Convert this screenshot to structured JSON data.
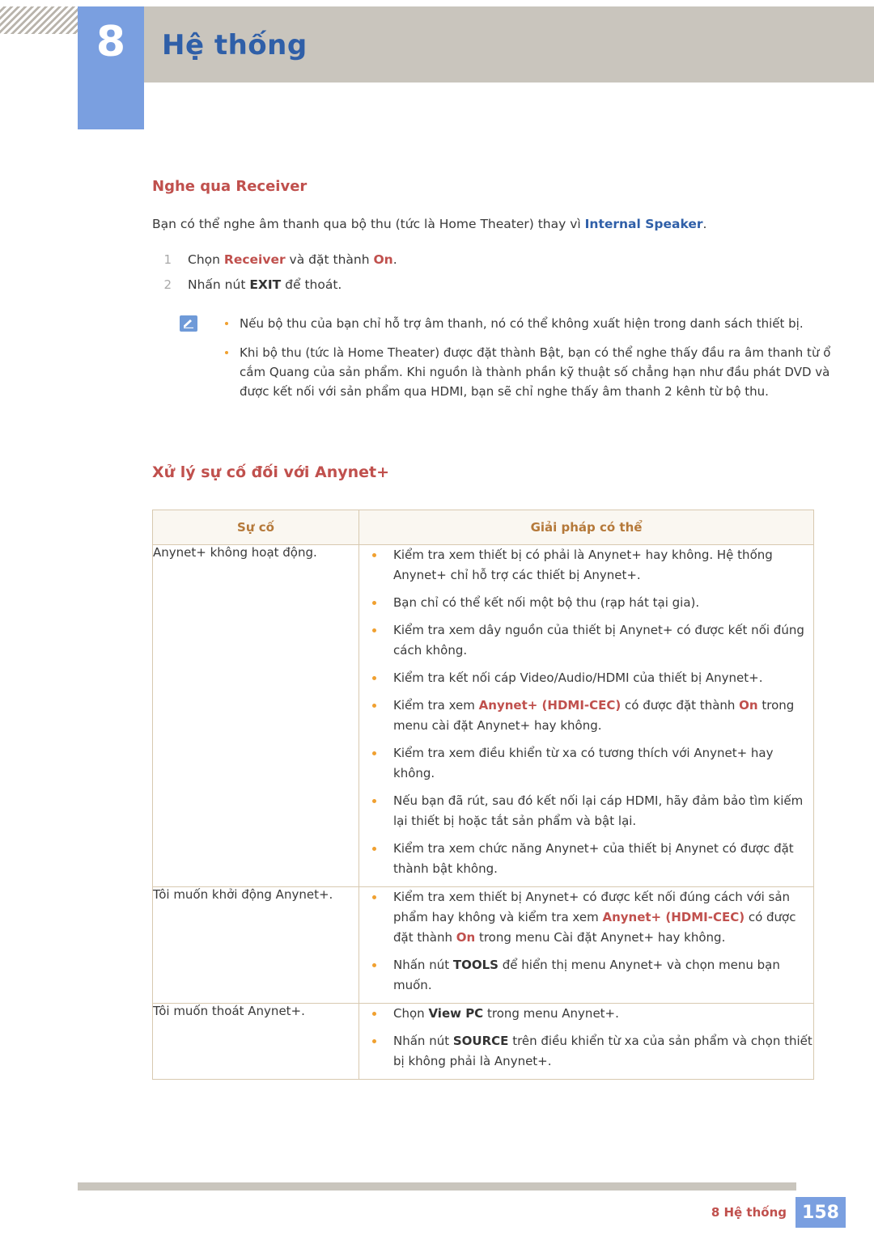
{
  "header": {
    "chapter_number": "8",
    "chapter_title": "Hệ thống"
  },
  "section1": {
    "title": "Nghe qua Receiver",
    "intro_pre": "Bạn có thể nghe âm thanh qua bộ thu (tức là Home Theater) thay vì ",
    "intro_kw": "Internal Speaker",
    "intro_post": ".",
    "steps": [
      {
        "num": "1",
        "pre": "Chọn ",
        "kw1": "Receiver",
        "mid": " và đặt thành ",
        "kw2": "On",
        "post": "."
      },
      {
        "num": "2",
        "pre": "Nhấn nút ",
        "kw1": "EXIT",
        "mid": " để thoát.",
        "kw2": "",
        "post": ""
      }
    ],
    "notes": [
      "Nếu bộ thu của bạn chỉ hỗ trợ âm thanh, nó có thể không xuất hiện trong danh sách thiết bị.",
      "Khi bộ thu (tức là Home Theater) được đặt thành Bật, bạn có thể nghe thấy đầu ra âm thanh từ ổ cắm Quang của sản phẩm. Khi nguồn là thành phần kỹ thuật số chẳng hạn như đầu phát DVD và được kết nối với sản phẩm qua HDMI, bạn sẽ chỉ nghe thấy âm thanh 2 kênh từ bộ thu."
    ]
  },
  "section2": {
    "title": "Xử lý sự cố đối với Anynet+",
    "table": {
      "headers": [
        "Sự cố",
        "Giải pháp có thể"
      ],
      "rows": [
        {
          "problem": "Anynet+ không hoạt động.",
          "solutions": [
            {
              "t1": "Kiểm tra xem thiết bị có phải là Anynet+ hay không. Hệ thống Anynet+ chỉ hỗ trợ các thiết bị Anynet+."
            },
            {
              "t1": "Bạn chỉ có thể kết nối một bộ thu (rạp hát tại gia)."
            },
            {
              "t1": "Kiểm tra xem dây nguồn của thiết bị Anynet+ có được kết nối đúng cách không."
            },
            {
              "t1": "Kiểm tra kết nối cáp Video/Audio/HDMI của thiết bị Anynet+."
            },
            {
              "t1": "Kiểm tra xem ",
              "kw1": "Anynet+ (HDMI-CEC)",
              "t2": " có được đặt thành ",
              "kw2": "On",
              "t3": " trong menu cài đặt Anynet+ hay không."
            },
            {
              "t1": "Kiểm tra xem điều khiển từ xa có tương thích với Anynet+ hay không."
            },
            {
              "t1": "Nếu bạn đã rút, sau đó kết nối lại cáp HDMI, hãy đảm bảo tìm kiếm lại thiết bị hoặc tắt sản phẩm và bật lại."
            },
            {
              "t1": "Kiểm tra xem chức năng Anynet+ của thiết bị Anynet có được đặt thành bật không."
            }
          ]
        },
        {
          "problem": "Tôi muốn khởi động Anynet+.",
          "solutions": [
            {
              "t1": "Kiểm tra xem thiết bị Anynet+ có được kết nối đúng cách với sản phẩm hay không và kiểm tra xem ",
              "kw1": "Anynet+ (HDMI-CEC)",
              "t2": " có được đặt thành ",
              "kw2": "On",
              "t3": " trong menu Cài đặt Anynet+ hay không."
            },
            {
              "t1": "Nhấn nút ",
              "kw1": "TOOLS",
              "t2": " để hiển thị menu Anynet+ và chọn menu bạn muốn."
            }
          ]
        },
        {
          "problem": "Tôi muốn thoát Anynet+.",
          "solutions": [
            {
              "t1": "Chọn ",
              "kw1": "View PC",
              "t2": " trong menu Anynet+."
            },
            {
              "t1": "Nhấn nút ",
              "kw1": "SOURCE",
              "t2": " trên điều khiển từ xa của sản phẩm và chọn thiết bị không phải là Anynet+."
            }
          ]
        }
      ]
    }
  },
  "footer": {
    "label": "8 Hệ thống",
    "page": "158"
  }
}
